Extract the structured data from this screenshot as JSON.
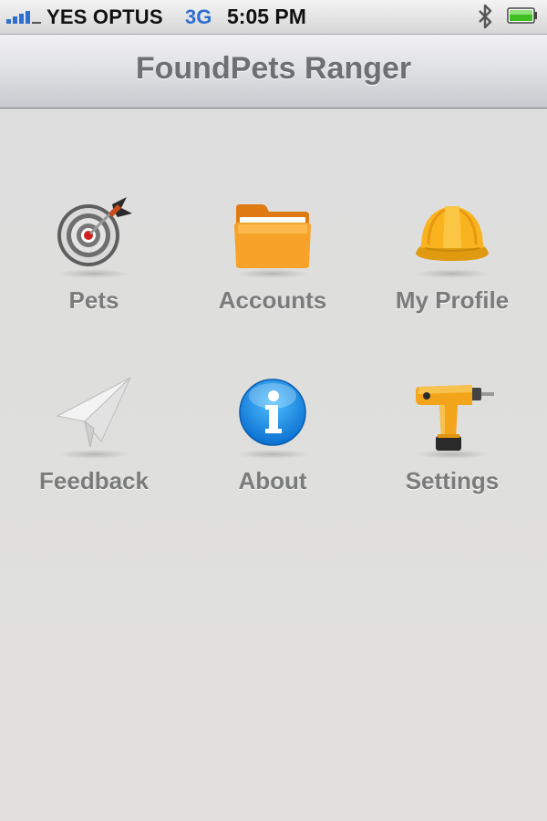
{
  "status_bar": {
    "carrier": "YES OPTUS",
    "network": "3G",
    "time": "5:05 PM",
    "icons": [
      "signal-bars-icon",
      "bluetooth-icon",
      "battery-icon"
    ]
  },
  "nav_bar": {
    "title": "FoundPets Ranger"
  },
  "menu": {
    "items": [
      {
        "label": "Pets",
        "icon": "dartboard-icon"
      },
      {
        "label": "Accounts",
        "icon": "folder-icon"
      },
      {
        "label": "My Profile",
        "icon": "hard-hat-icon"
      },
      {
        "label": "Feedback",
        "icon": "paper-plane-icon"
      },
      {
        "label": "About",
        "icon": "info-icon"
      },
      {
        "label": "Settings",
        "icon": "power-drill-icon"
      }
    ]
  },
  "colors": {
    "label_gray": "#7a7b7b",
    "title_gray": "#6e6f73",
    "accent_blue": "#2f6fd0",
    "battery_green": "#3fbf1f"
  }
}
